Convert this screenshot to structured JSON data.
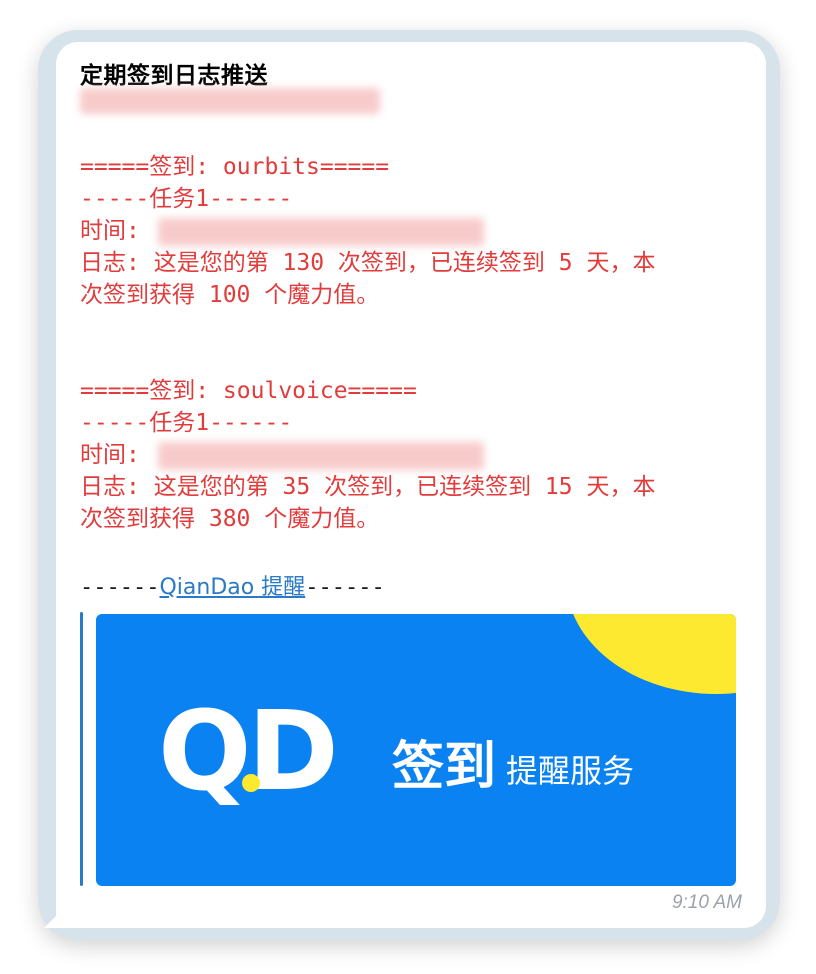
{
  "message": {
    "title": "定期签到日志推送",
    "time": "9:10 AM",
    "entries": [
      {
        "header": "=====签到: ourbits=====",
        "task": "-----任务1------",
        "time_label": "时间:",
        "log_line1": "日志: 这是您的第 130 次签到，已连续签到 5 天，本",
        "log_line2": "次签到获得 100 个魔力值。"
      },
      {
        "header": "=====签到: soulvoice=====",
        "task": "-----任务1------",
        "time_label": "时间:",
        "log_line1": "日志: 这是您的第 35 次签到，已连续签到 15 天，本",
        "log_line2": "次签到获得 380 个魔力值。"
      }
    ],
    "footer_prefix": "------",
    "footer_link": "QianDao 提醒",
    "footer_suffix": "------",
    "preview": {
      "logo": "QD",
      "main": "签到",
      "sub": "提醒服务"
    }
  },
  "colors": {
    "log_text": "#e23b3b",
    "link": "#2a7ac7",
    "banner_blue": "#0b82f2",
    "banner_yellow": "#fde92f"
  }
}
